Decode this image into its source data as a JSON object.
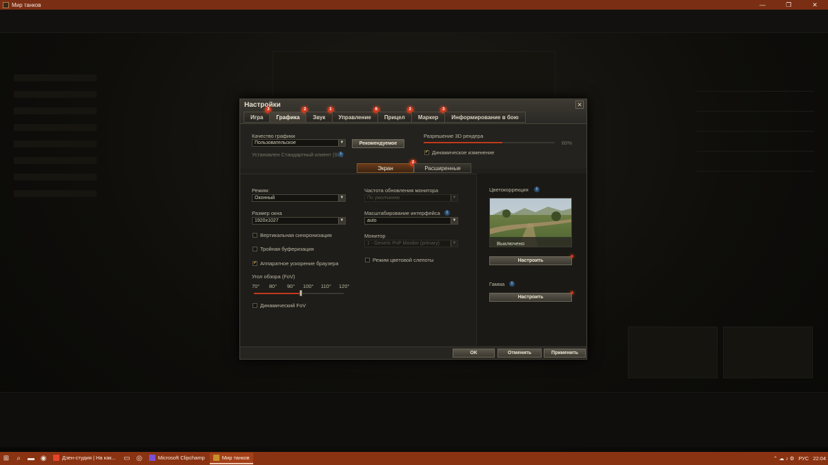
{
  "window": {
    "title": "Мир танков",
    "minimize": "—",
    "maximize": "❐",
    "close": "✕"
  },
  "dialog": {
    "title": "Настройки",
    "tabs": [
      {
        "label": "Игра",
        "badge": "3"
      },
      {
        "label": "Графика",
        "badge": "2"
      },
      {
        "label": "Звук",
        "badge": "1"
      },
      {
        "label": "Управление",
        "badge": "6"
      },
      {
        "label": "Прицел",
        "badge": "2"
      },
      {
        "label": "Маркер",
        "badge": "3"
      },
      {
        "label": "Информирование в бою",
        "badge": ""
      }
    ],
    "active_tab": "Графика",
    "quality_label": "Качество графики",
    "quality_value": "Пользовательское",
    "recommended_button": "Рекомендуемое",
    "client_note": "Установлен Стандартный клиент (SD)",
    "render_label": "Разрешение 3D рендера",
    "render_value": "60%",
    "render_fraction": 0.6,
    "dynamic_change_label": "Динамическое изменение",
    "dynamic_change_checked": true,
    "subtabs": [
      {
        "label": "Экран",
        "badge": "2",
        "active": true
      },
      {
        "label": "Расширенные",
        "badge": "",
        "active": false
      }
    ],
    "mode_label": "Режим:",
    "mode_value": "Оконный",
    "window_size_label": "Размер окна",
    "window_size_value": "1920x1027",
    "vsync_label": "Вертикальная синхронизация",
    "vsync_checked": false,
    "triple_buffer_label": "Тройная буферизация",
    "triple_buffer_checked": false,
    "browser_accel_label": "Аппаратное ускорение браузера",
    "browser_accel_checked": true,
    "fov_label": "Угол обзора (FoV)",
    "fov_ticks": [
      "70°",
      "80°",
      "90°",
      "100°",
      "110°",
      "120°"
    ],
    "fov_fraction": 0.52,
    "dynamic_fov_label": "Динамический FoV",
    "dynamic_fov_checked": false,
    "refresh_label": "Частота обновления монитора",
    "refresh_value": "По умолчанию",
    "ui_scale_label": "Масштабирование интерфейса",
    "ui_scale_value": "auto",
    "monitor_label": "Монитор",
    "monitor_value": "1 - Generic PnP Monitor (primary)",
    "colorblind_label": "Режим цветовой слепоты",
    "colorblind_checked": false,
    "color_correction_label": "Цветокоррекция",
    "color_correction_state": "Выключено",
    "configure_button": "Настроить",
    "gamma_label": "Гамма",
    "gamma_button": "Настроить",
    "ok_button": "OK",
    "cancel_button": "Отменить",
    "apply_button": "Применить"
  },
  "taskbar": {
    "apps": [
      {
        "label": "Дзен-студия | На как...",
        "icon_color": "#e8432b",
        "active": false
      },
      {
        "label": "Microsoft Clipchamp",
        "icon_color": "#7a4fd8",
        "active": false
      },
      {
        "label": "Мир танков",
        "icon_color": "#c7912a",
        "active": true
      }
    ],
    "tray_lang": "РУС",
    "tray_time": "22:04"
  },
  "colors": {
    "accent": "#c23a1a",
    "badge": "#d23a1e",
    "taskbar": "#8a3312"
  }
}
